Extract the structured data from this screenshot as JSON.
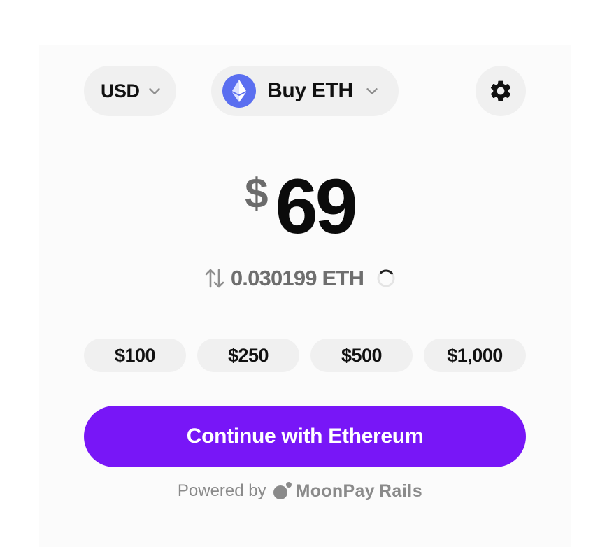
{
  "currency_selector": {
    "label": "USD",
    "icon": "chevron-down-icon"
  },
  "asset_selector": {
    "label": "Buy ETH",
    "icon": "ethereum-icon",
    "accent": "#5b6ff0"
  },
  "settings": {
    "icon": "gear-icon"
  },
  "amount": {
    "symbol": "$",
    "value": "69"
  },
  "conversion": {
    "text": "0.030199 ETH",
    "icon": "swap-vertical-icon",
    "status_icon": "loading-spinner-icon"
  },
  "presets": [
    "$100",
    "$250",
    "$500",
    "$1,000"
  ],
  "cta": {
    "label": "Continue with Ethereum",
    "color": "#7816f7"
  },
  "footer": {
    "powered_by": "Powered by",
    "brand": "MoonPay",
    "brand_suffix": "Rails"
  }
}
